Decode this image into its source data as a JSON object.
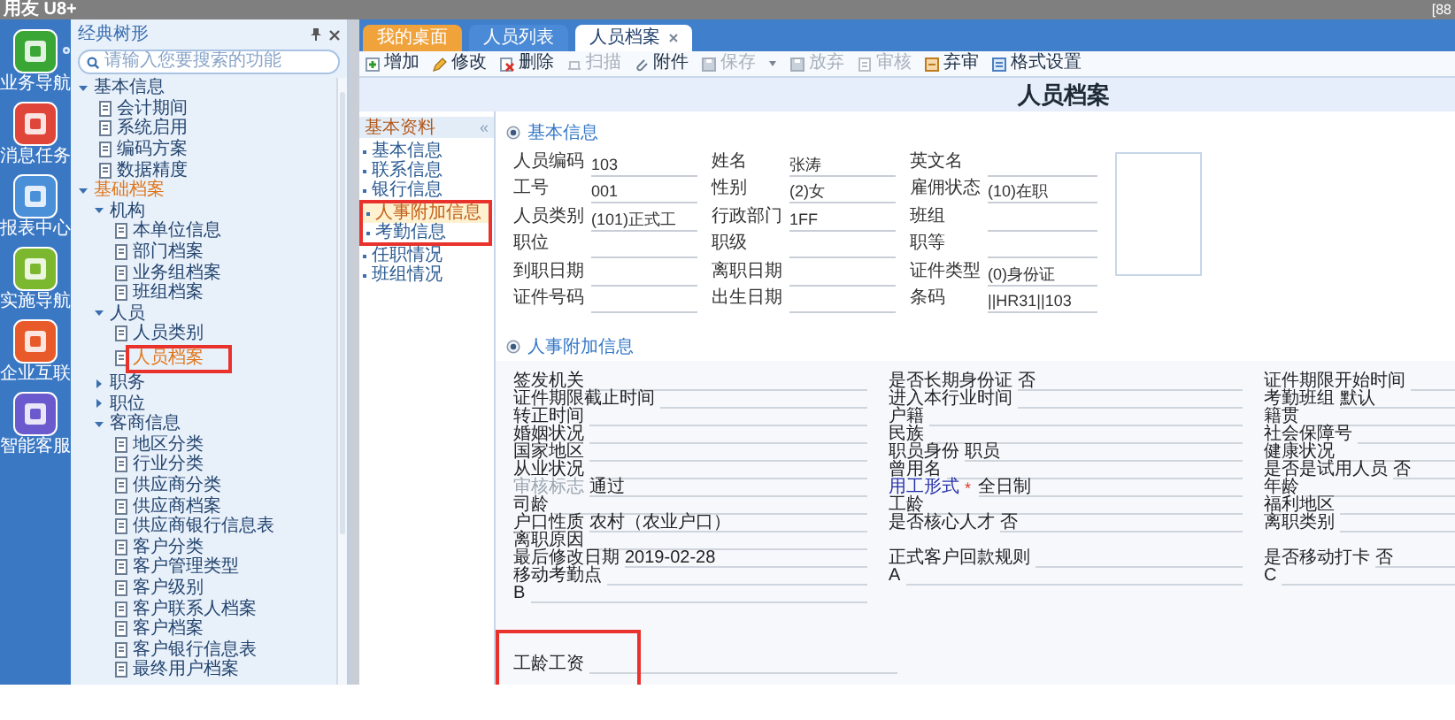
{
  "app_title": "用友 U8+",
  "title_right": "[88",
  "dock": [
    {
      "label": "业务导航",
      "color": "#3aa635"
    },
    {
      "label": "消息任务",
      "color": "#e0453a"
    },
    {
      "label": "报表中心",
      "color": "#4a90d9"
    },
    {
      "label": "实施导航",
      "color": "#7cb82f"
    },
    {
      "label": "企业互联",
      "color": "#e85a2a"
    },
    {
      "label": "智能客服",
      "color": "#6a5acd"
    }
  ],
  "nav": {
    "title": "经典树形",
    "search": {
      "placeholder": "请输入您要搜索的功能"
    },
    "tree": [
      {
        "label": "基本信息",
        "expanded": true,
        "selected": false,
        "highlighted": false,
        "children": [
          {
            "label": "会计期间",
            "selected": false,
            "highlighted": false
          },
          {
            "label": "系统启用",
            "selected": false,
            "highlighted": false
          },
          {
            "label": "编码方案",
            "selected": false,
            "highlighted": false
          },
          {
            "label": "数据精度",
            "selected": false,
            "highlighted": false
          }
        ]
      },
      {
        "label": "基础档案",
        "expanded": true,
        "selected": true,
        "highlighted": false,
        "children": [
          {
            "label": "机构",
            "expanded": true,
            "selected": false,
            "highlighted": false,
            "children": [
              {
                "label": "本单位信息",
                "selected": false,
                "highlighted": false
              },
              {
                "label": "部门档案",
                "selected": false,
                "highlighted": false
              },
              {
                "label": "业务组档案",
                "selected": false,
                "highlighted": false
              },
              {
                "label": "班组档案",
                "selected": false,
                "highlighted": false
              }
            ]
          },
          {
            "label": "人员",
            "expanded": true,
            "selected": false,
            "highlighted": false,
            "children": [
              {
                "label": "人员类别",
                "selected": false,
                "highlighted": false
              },
              {
                "label": "人员档案",
                "selected": true,
                "highlighted": true
              }
            ]
          },
          {
            "label": "职务",
            "expanded": false,
            "selected": false,
            "highlighted": false
          },
          {
            "label": "职位",
            "expanded": false,
            "selected": false,
            "highlighted": false
          },
          {
            "label": "客商信息",
            "expanded": true,
            "selected": false,
            "highlighted": false,
            "children": [
              {
                "label": "地区分类",
                "selected": false,
                "highlighted": false
              },
              {
                "label": "行业分类",
                "selected": false,
                "highlighted": false
              },
              {
                "label": "供应商分类",
                "selected": false,
                "highlighted": false
              },
              {
                "label": "供应商档案",
                "selected": false,
                "highlighted": false
              },
              {
                "label": "供应商银行信息表",
                "selected": false,
                "highlighted": false
              },
              {
                "label": "客户分类",
                "selected": false,
                "highlighted": false
              },
              {
                "label": "客户管理类型",
                "selected": false,
                "highlighted": false
              },
              {
                "label": "客户级别",
                "selected": false,
                "highlighted": false
              },
              {
                "label": "客户联系人档案",
                "selected": false,
                "highlighted": false
              },
              {
                "label": "客户档案",
                "selected": false,
                "highlighted": false
              },
              {
                "label": "客户银行信息表",
                "selected": false,
                "highlighted": false
              },
              {
                "label": "最终用户档案",
                "selected": false,
                "highlighted": false
              }
            ]
          }
        ]
      }
    ]
  },
  "tabs": [
    {
      "label": "我的桌面",
      "kind": "home",
      "selected": false,
      "closable": false
    },
    {
      "label": "人员列表",
      "kind": "normal",
      "selected": false,
      "closable": false
    },
    {
      "label": "人员档案",
      "kind": "normal",
      "selected": true,
      "closable": true
    }
  ],
  "toolbar": [
    {
      "label": "增加",
      "disabled": false,
      "menu": false
    },
    {
      "label": "修改",
      "disabled": false,
      "menu": false
    },
    {
      "label": "删除",
      "disabled": false,
      "menu": false
    },
    {
      "label": "扫描",
      "disabled": true,
      "menu": false
    },
    {
      "label": "附件",
      "disabled": false,
      "menu": false
    },
    {
      "label": "保存",
      "disabled": true,
      "menu": true
    },
    {
      "label": "放弃",
      "disabled": true,
      "menu": false
    },
    {
      "label": "审核",
      "disabled": true,
      "menu": false
    },
    {
      "label": "弃审",
      "disabled": false,
      "menu": false
    },
    {
      "label": "格式设置",
      "disabled": false,
      "menu": false
    }
  ],
  "page_title": "人员档案",
  "side": {
    "title": "基本资料",
    "collapse": "«",
    "items": [
      {
        "label": "基本信息",
        "selected": false,
        "highlighted": false
      },
      {
        "label": "联系信息",
        "selected": false,
        "highlighted": false
      },
      {
        "label": "银行信息",
        "selected": false,
        "highlighted": false
      },
      {
        "label": "人事附加信息",
        "selected": true,
        "highlighted": true
      },
      {
        "label": "考勤信息",
        "selected": false,
        "highlighted": true
      },
      {
        "label": "任职情况",
        "selected": false,
        "highlighted": false
      },
      {
        "label": "班组情况",
        "selected": false,
        "highlighted": false
      }
    ]
  },
  "basic": {
    "title": "基本信息",
    "rows": [
      [
        {
          "label": "人员编码",
          "value": "103"
        },
        {
          "label": "姓名",
          "value": "张涛"
        },
        {
          "label": "英文名"
        }
      ],
      [
        {
          "label": "工号",
          "value": "001"
        },
        {
          "label": "性别",
          "value": "(2)女"
        },
        {
          "label": "雇佣状态",
          "value": "(10)在职"
        }
      ],
      [
        {
          "label": "人员类别",
          "value": "(101)正式工"
        },
        {
          "label": "行政部门",
          "value": "1FF"
        },
        {
          "label": "班组"
        }
      ],
      [
        {
          "label": "职位"
        },
        {
          "label": "职级"
        },
        {
          "label": "职等"
        }
      ],
      [
        {
          "label": "到职日期"
        },
        {
          "label": "离职日期"
        },
        {
          "label": "证件类型",
          "value": "(0)身份证"
        }
      ],
      [
        {
          "label": "证件号码"
        },
        {
          "label": "出生日期"
        },
        {
          "label": "条码",
          "value": "||HR31||103"
        }
      ]
    ]
  },
  "extra": {
    "title": "人事附加信息",
    "columns": [
      [
        [
          {
            "label": "签发机关",
            "kind": "normal"
          },
          {
            "label": "证件期限截止时间",
            "kind": "normal"
          },
          {
            "label": "转正时间",
            "kind": "normal"
          },
          {
            "label": "婚姻状况",
            "kind": "normal"
          },
          {
            "label": "国家地区",
            "kind": "normal"
          },
          {
            "label": "从业状况",
            "kind": "normal"
          },
          {
            "label": "审核标志",
            "kind": "muted",
            "value": "通过"
          },
          {
            "label": "司龄",
            "kind": "normal"
          },
          {
            "label": "户口性质",
            "kind": "normal",
            "value": "农村（农业户口）"
          },
          {
            "label": "离职原因",
            "kind": "normal"
          },
          {
            "label": "最后修改日期",
            "kind": "normal",
            "value": "2019-02-28"
          },
          {
            "label": "移动考勤点",
            "kind": "normal"
          },
          {
            "label": "B",
            "kind": "normal"
          }
        ]
      ],
      [
        [
          {
            "label": "是否长期身份证",
            "kind": "normal",
            "value": "否"
          },
          {
            "label": "进入本行业时间",
            "kind": "normal"
          },
          {
            "label": "户籍",
            "kind": "normal"
          },
          {
            "label": "民族",
            "kind": "normal"
          },
          {
            "label": "职员身份",
            "kind": "normal",
            "value": "职员"
          },
          {
            "label": "曾用名",
            "kind": "normal"
          },
          {
            "label": "用工形式",
            "kind": "required",
            "marker": "*",
            "value": "全日制"
          },
          {
            "label": "工龄",
            "kind": "normal"
          },
          {
            "label": "是否核心人才",
            "kind": "normal",
            "value": "否"
          }
        ],
        [
          {
            "label": "正式客户回款规则",
            "kind": "normal"
          },
          {
            "label": "A",
            "kind": "normal"
          }
        ]
      ],
      [
        [
          {
            "label": "证件期限开始时间",
            "kind": "normal"
          },
          {
            "label": "考勤班组",
            "kind": "normal",
            "value": "默认"
          },
          {
            "label": "籍贯",
            "kind": "normal"
          },
          {
            "label": "社会保障号",
            "kind": "normal"
          },
          {
            "label": "健康状况",
            "kind": "normal"
          },
          {
            "label": "是否是试用人员",
            "kind": "normal",
            "value": "否"
          },
          {
            "label": "年龄",
            "kind": "normal"
          },
          {
            "label": "福利地区",
            "kind": "normal"
          },
          {
            "label": "离职类别",
            "kind": "normal"
          }
        ],
        [
          {
            "label": "是否移动打卡",
            "kind": "normal",
            "value": "否"
          },
          {
            "label": "C",
            "kind": "normal"
          }
        ]
      ]
    ],
    "footer": [
      {
        "label": "工龄工资",
        "kind": "normal",
        "highlighted": true
      }
    ]
  }
}
